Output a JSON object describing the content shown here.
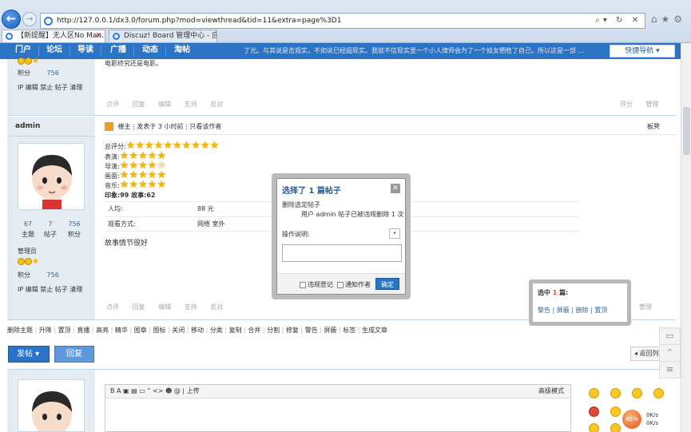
{
  "browser": {
    "url": "http://127.0.0.1/dx3.0/forum.php?mod=viewthread&tid=11&extra=page%3D1",
    "tabs": [
      {
        "label": "【新提醒】无人区No Man..."
      },
      {
        "label": "Discuz! Board 管理中心 - 应..."
      }
    ]
  },
  "nav": {
    "items": [
      "门户",
      "论坛",
      "导读",
      "广播",
      "动态",
      "淘帖"
    ],
    "quick_nav": "快捷导航 ▾"
  },
  "post1": {
    "body_tail": "电影终究还是电影。",
    "body_top": "了光。与其说是击观实，不如说已经超现实。我就不信现实里一个小人律师会为了一个妓女牺牲了自己。所以这是一部 ...",
    "points_label": "积分",
    "points_value": "756",
    "admin_links": "IP 编辑 禁止 帖子 清理",
    "actions": [
      "点评",
      "回复",
      "编辑",
      "支持",
      "反对"
    ],
    "right_actions": "评分",
    "manage": "管理"
  },
  "post2": {
    "author": "admin",
    "owner_badge": "楼主",
    "posted": "发表于 3 小时前",
    "only_author": "只看该作者",
    "floor": "板凳",
    "stats": [
      {
        "value": "67",
        "label": "主题"
      },
      {
        "value": "7",
        "label": "帖子"
      },
      {
        "value": "756",
        "label": "积分"
      }
    ],
    "group": "管理员",
    "points_label": "积分",
    "points_value": "756",
    "admin_links": "IP 编辑 禁止 帖子 清理",
    "ratings": [
      {
        "label": "总评分:",
        "stars": 10,
        "max": 10
      },
      {
        "label": "表演:",
        "stars": 5,
        "max": 5
      },
      {
        "label": "导演:",
        "stars": 4,
        "max": 5
      },
      {
        "label": "画面:",
        "stars": 5,
        "max": 5
      },
      {
        "label": "音乐:",
        "stars": 5,
        "max": 5
      }
    ],
    "impression": "印象:99  故事:62",
    "per_capita_label": "人均:",
    "per_capita_value": "88 元",
    "watch_label": "观看方式:",
    "watch_value": "网络 室外",
    "content": "故事情节很好",
    "actions": [
      "点评",
      "回复",
      "编辑",
      "支持",
      "反对"
    ],
    "manage": "管理"
  },
  "dialog": {
    "title": "选择了 1 篇帖子",
    "close": "✕",
    "line1": "删除选定帖子",
    "line2": "用户 admin 帖子已被违规删除 1 次",
    "op_label": "操作说明:",
    "chk1": "违规登记",
    "chk2": "通知作者",
    "ok": "确定"
  },
  "selection": {
    "prefix": "选中",
    "count": "1",
    "suffix": "篇:",
    "links": [
      "警告",
      "屏蔽",
      "删除",
      "置顶"
    ]
  },
  "mod_bar": [
    "删除主题",
    "升降",
    "置顶",
    "直播",
    "高亮",
    "精华",
    "图章",
    "图标",
    "关闭",
    "移动",
    "分类",
    "复制",
    "合并",
    "分割",
    "修复",
    "警告",
    "屏蔽",
    "标签",
    "生成文章"
  ],
  "post_btn": "发帖 ▾",
  "reply_btn": "回复",
  "back_list": "◂ 返回列表",
  "editor": {
    "tools": "B  A  ▣  ▤  ▭  “  <>  ☻  @  |  上传",
    "advanced": "高级模式"
  },
  "speed": {
    "percent": "85%",
    "up": "0K/s",
    "down": "0K/s"
  }
}
